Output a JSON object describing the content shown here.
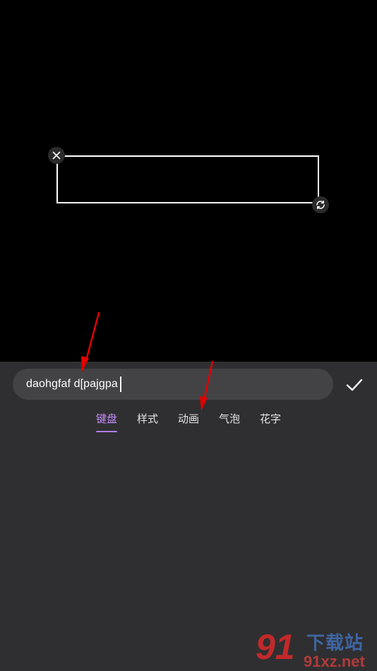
{
  "editor": {
    "input_value": "daohgfaf d[pajgpa",
    "tabs": [
      {
        "label": "键盘",
        "active": true
      },
      {
        "label": "样式",
        "active": false
      },
      {
        "label": "动画",
        "active": false
      },
      {
        "label": "气泡",
        "active": false
      },
      {
        "label": "花字",
        "active": false
      }
    ]
  },
  "icons": {
    "close": "close-icon",
    "rotate": "rotate-icon",
    "confirm": "checkmark-icon"
  },
  "colors": {
    "preview_bg": "#000000",
    "panel_bg": "#2f2f31",
    "input_bg": "#434345",
    "accent": "#c88dff",
    "annotation_arrow": "#e00000"
  },
  "watermark": {
    "number": "91",
    "name": "下载站",
    "domain": "91xz.net"
  }
}
